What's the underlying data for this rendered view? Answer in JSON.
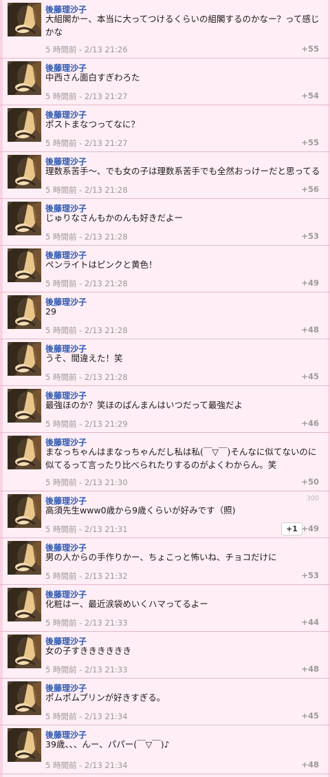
{
  "comments": [
    {
      "author": "後藤理沙子",
      "text": "大組閣かー、本当に大ってつけるくらいの組閣するのかなー？って感じかな",
      "time": "5 時間前 - 2/13 21:26",
      "score": "+55"
    },
    {
      "author": "後藤理沙子",
      "text": "中西さん面白すぎわろた",
      "time": "5 時間前 - 2/13 21:27",
      "score": "+54"
    },
    {
      "author": "後藤理沙子",
      "text": "ポストまなつってなに？",
      "time": "5 時間前 - 2/13 21:27",
      "score": "+55"
    },
    {
      "author": "後藤理沙子",
      "text": "理数系苦手〜、でも女の子は理数系苦手でも全然おっけーだと思ってる",
      "time": "5 時間前 - 2/13 21:28",
      "score": "+56"
    },
    {
      "author": "後藤理沙子",
      "text": "じゅりなさんもかのんも好きだよー",
      "time": "5 時間前 - 2/13 21:28",
      "score": "+53"
    },
    {
      "author": "後藤理沙子",
      "text": "ペンライトはピンクと黄色！",
      "time": "5 時間前 - 2/13 21:28",
      "score": "+49"
    },
    {
      "author": "後藤理沙子",
      "text": "29",
      "time": "5 時間前 - 2/13 21:28",
      "score": "+48"
    },
    {
      "author": "後藤理沙子",
      "text": "うそ、間違えた！笑",
      "time": "5 時間前 - 2/13 21:28",
      "score": "+45"
    },
    {
      "author": "後藤理沙子",
      "text": "最強ほのか？笑ほのぱんまんはいつだって最強だよ",
      "time": "5 時間前 - 2/13 21:29",
      "score": "+46"
    },
    {
      "author": "後藤理沙子",
      "text": "まなっちゃんはまなっちゃんだし私は私(￣▽￣)そんなに似てないのに似てるって言ったり比べられたりするのがよくわからん。笑",
      "time": "5 時間前 - 2/13 21:30",
      "score": "+50"
    },
    {
      "author": "後藤理沙子",
      "text": "高須先生www0歳から9歳くらいが好みです（照)",
      "time": "5 時間前 - 2/13 21:31",
      "score": "+49",
      "badge": "300",
      "plus_label": "+1"
    },
    {
      "author": "後藤理沙子",
      "text": "男の人からの手作りかー、ちょこっと怖いね、チョコだけに",
      "time": "5 時間前 - 2/13 21:32",
      "score": "+53"
    },
    {
      "author": "後藤理沙子",
      "text": "化粧はー、最近涙袋めいくハマってるよー",
      "time": "5 時間前 - 2/13 21:33",
      "score": "+44"
    },
    {
      "author": "後藤理沙子",
      "text": "女の子すきききききき",
      "time": "5 時間前 - 2/13 21:33",
      "score": "+48"
    },
    {
      "author": "後藤理沙子",
      "text": "ポムポムプリンが好きすぎる。",
      "time": "5 時間前 - 2/13 21:34",
      "score": "+45"
    },
    {
      "author": "後藤理沙子",
      "text": "39歳、、、んー、パパー(￣▽￣)♪",
      "time": "5 時間前 - 2/13 21:34",
      "score": "+48"
    }
  ],
  "colors": {
    "background": "#ffeef5",
    "author": "#2c58b2",
    "divider": "#e2b8c8",
    "meta": "#999999"
  },
  "icons": {
    "avatar": "profile-photo",
    "plus_one": "plus-one-button"
  }
}
